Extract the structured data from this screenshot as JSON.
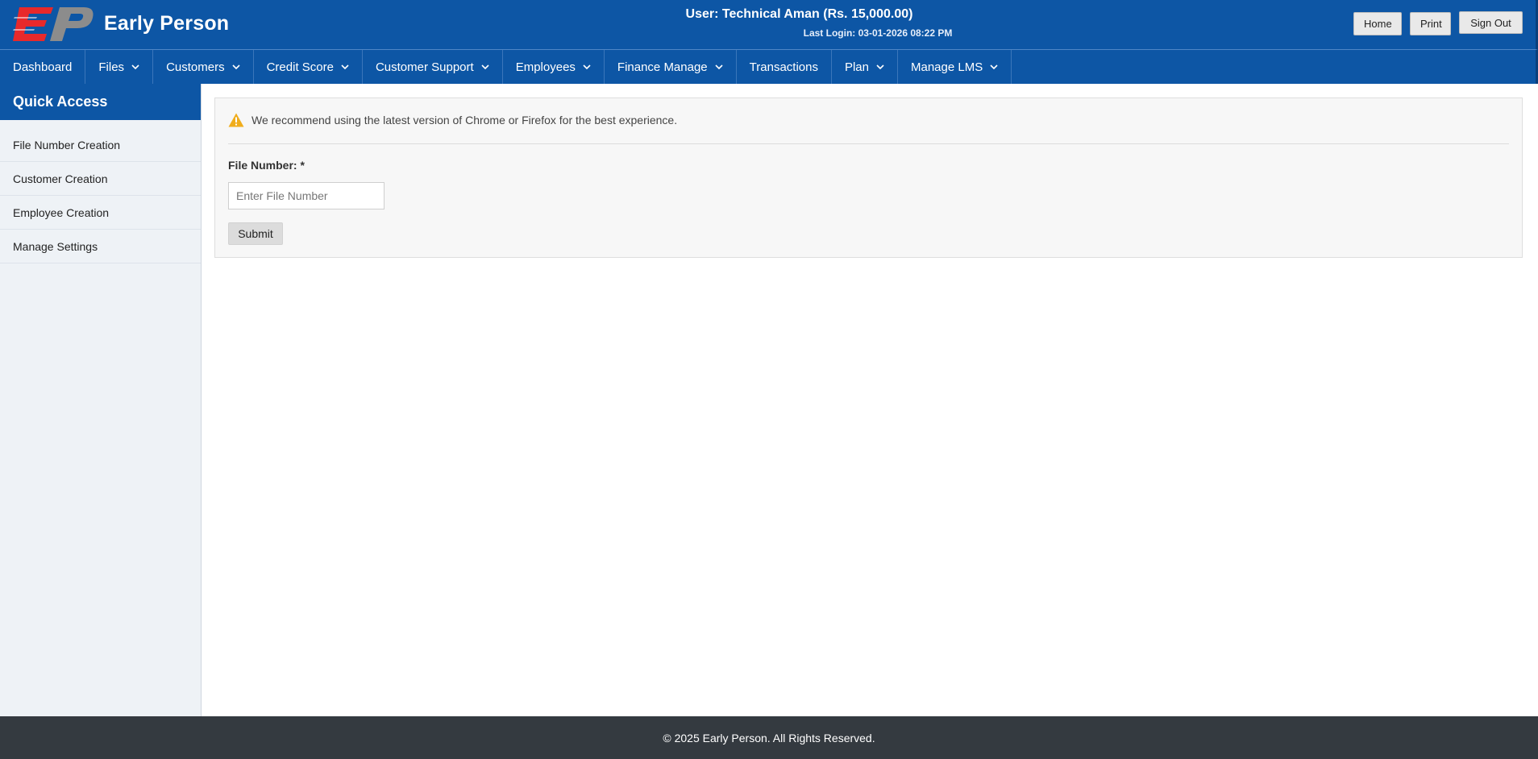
{
  "header": {
    "brand": "Early Person",
    "user_line": "User: Technical Aman (Rs. 15,000.00)",
    "last_login": "Last Login: 03-01-2026 08:22 PM",
    "buttons": {
      "home": "Home",
      "print": "Print",
      "sign_out": "Sign Out"
    },
    "logo_icon": "ep-logo",
    "colors": {
      "brand_blue": "#0d56a5",
      "logo_red": "#e8292b",
      "logo_gray": "#8a8a8a"
    }
  },
  "nav": {
    "items": [
      {
        "label": "Dashboard",
        "dropdown": false
      },
      {
        "label": "Files",
        "dropdown": true
      },
      {
        "label": "Customers",
        "dropdown": true
      },
      {
        "label": "Credit Score",
        "dropdown": true
      },
      {
        "label": "Customer Support",
        "dropdown": true
      },
      {
        "label": "Employees",
        "dropdown": true
      },
      {
        "label": "Finance Manage",
        "dropdown": true
      },
      {
        "label": "Transactions",
        "dropdown": false
      },
      {
        "label": "Plan",
        "dropdown": true
      },
      {
        "label": "Manage LMS",
        "dropdown": true
      }
    ],
    "dropdown_icon": "chevron-down-icon"
  },
  "sidebar": {
    "title": "Quick Access",
    "items": [
      {
        "label": "File Number Creation"
      },
      {
        "label": "Customer Creation"
      },
      {
        "label": "Employee Creation"
      },
      {
        "label": "Manage Settings"
      }
    ]
  },
  "main": {
    "notice_icon": "warning-icon",
    "notice": "We recommend using the latest version of Chrome or Firefox for the best experience.",
    "file_number_label": "File Number: *",
    "file_number_value": "",
    "file_number_placeholder": "Enter File Number",
    "submit_label": "Submit",
    "colors": {
      "warning": "#f0ad1c"
    }
  },
  "footer": {
    "text": "© 2025 Early Person. All Rights Reserved.",
    "color": "#343a40"
  }
}
